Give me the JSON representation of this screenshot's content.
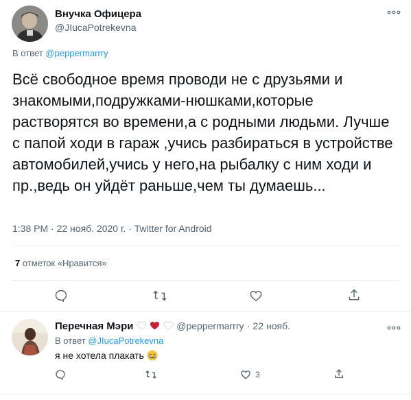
{
  "tweet": {
    "author_name": "Внучка Офицера",
    "author_handle": "@JIucaPotrekevna",
    "reply_prefix": "В ответ",
    "reply_to": "@peppermarrry",
    "text": "Всё свободное время проводи не с друзьями и знакомыми,подружками-нюшками,которые растворятся во времени,а с родными людьми. Лучше с папой ходи в гараж ,учись разбираться в устройстве автомобилей,учись у него,на рыбалку с ним ходи и пр.,ведь он уйдёт раньше,чем ты думаешь...",
    "time": "1:38 PM",
    "date": "22 нояб. 2020 г.",
    "source": "Twitter for Android",
    "likes_count": "7",
    "likes_label": "отметок «Нравится»"
  },
  "reply": {
    "author_name": "Перечная Мэри",
    "author_handle": "@peppermarrry",
    "date": "22 нояб.",
    "reply_prefix": "В ответ",
    "reply_to": "@JIucaPotrekevna",
    "text": "я не хотела плакать",
    "like_count": "3"
  },
  "colors": {
    "accent": "#1d9bf0",
    "muted": "#536471",
    "text": "#0f1419",
    "heart_red": "#e0245e"
  },
  "icons": [
    "more-icon",
    "reply-icon",
    "retweet-icon",
    "like-icon",
    "share-icon",
    "crying-face-emoji",
    "heart-emoji"
  ]
}
